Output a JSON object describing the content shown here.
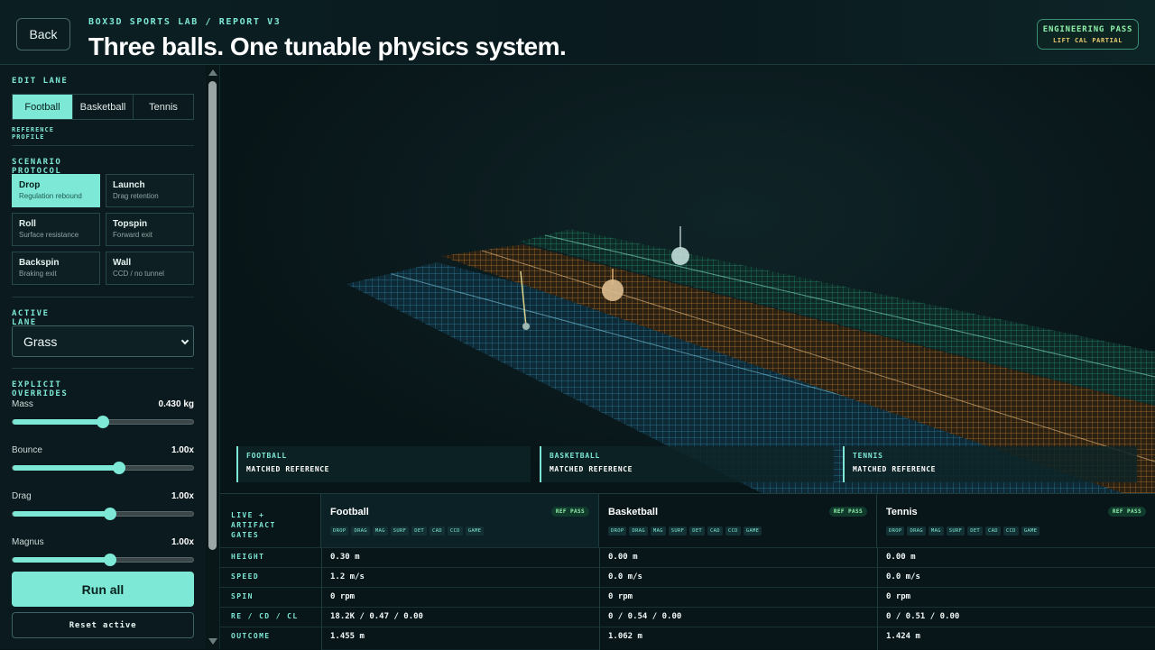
{
  "header": {
    "back_label": "Back",
    "kicker": "BOX3D SPORTS LAB / REPORT V3",
    "title": "Three balls. One tunable physics system.",
    "badge_title": "ENGINEERING PASS",
    "badge_subtitle": "LIFT CAL PARTIAL"
  },
  "sidebar": {
    "edit_lane_label": "EDIT LANE",
    "lanes": [
      "Football",
      "Basketball",
      "Tennis"
    ],
    "active_lane": "Football",
    "reference_label": "REFERENCE PROFILE",
    "scenario_label": "SCENARIO PROTOCOL",
    "scenarios": [
      {
        "title": "Drop",
        "subtitle": "Regulation rebound"
      },
      {
        "title": "Launch",
        "subtitle": "Drag retention"
      },
      {
        "title": "Roll",
        "subtitle": "Surface resistance"
      },
      {
        "title": "Topspin",
        "subtitle": "Forward exit"
      },
      {
        "title": "Backspin",
        "subtitle": "Braking exit"
      },
      {
        "title": "Wall",
        "subtitle": "CCD / no tunnel"
      }
    ],
    "active_scenario": "Drop",
    "surface_label": "ACTIVE LANE SURFACE",
    "surface_value": "Grass",
    "overrides_label": "EXPLICIT OVERRIDES",
    "sliders": [
      {
        "label": "Mass",
        "value": "0.430 kg",
        "level": 0.5
      },
      {
        "label": "Bounce",
        "value": "1.00x",
        "level": 0.59
      },
      {
        "label": "Drag",
        "value": "1.00x",
        "level": 0.54
      },
      {
        "label": "Magnus",
        "value": "1.00x",
        "level": 0.54
      }
    ],
    "run_label": "Run all",
    "reset_label": "Reset active"
  },
  "viewport": {
    "lane_status": [
      {
        "name": "FOOTBALL",
        "status": "MATCHED REFERENCE"
      },
      {
        "name": "BASKETBALL",
        "status": "MATCHED REFERENCE"
      },
      {
        "name": "TENNIS",
        "status": "MATCHED REFERENCE"
      }
    ],
    "colors": {
      "lane_blue": "#3aa0c8",
      "lane_orange": "#d6903c",
      "lane_green": "#2f9f86",
      "accent": "#7ee8d6"
    }
  },
  "table": {
    "gates_label": "LIVE + ARTIFACT GATES",
    "columns": [
      {
        "name": "Football",
        "pass": "REF PASS"
      },
      {
        "name": "Basketball",
        "pass": "REF PASS"
      },
      {
        "name": "Tennis",
        "pass": "REF PASS"
      }
    ],
    "chips": [
      "DROP",
      "DRAG",
      "MAG",
      "SURF",
      "DET",
      "CAD",
      "CCD",
      "GAME"
    ],
    "rows": [
      {
        "label": "HEIGHT",
        "values": [
          "0.30 m",
          "0.00 m",
          "0.00 m"
        ]
      },
      {
        "label": "SPEED",
        "values": [
          "1.2 m/s",
          "0.0 m/s",
          "0.0 m/s"
        ]
      },
      {
        "label": "SPIN",
        "values": [
          "0 rpm",
          "0 rpm",
          "0 rpm"
        ]
      },
      {
        "label": "RE / CD / CL",
        "values": [
          "18.2K / 0.47 / 0.00",
          "0 / 0.54 / 0.00",
          "0 / 0.51 / 0.00"
        ]
      },
      {
        "label": "OUTCOME",
        "values": [
          "1.455 m",
          "1.062 m",
          "1.424 m"
        ]
      }
    ]
  }
}
